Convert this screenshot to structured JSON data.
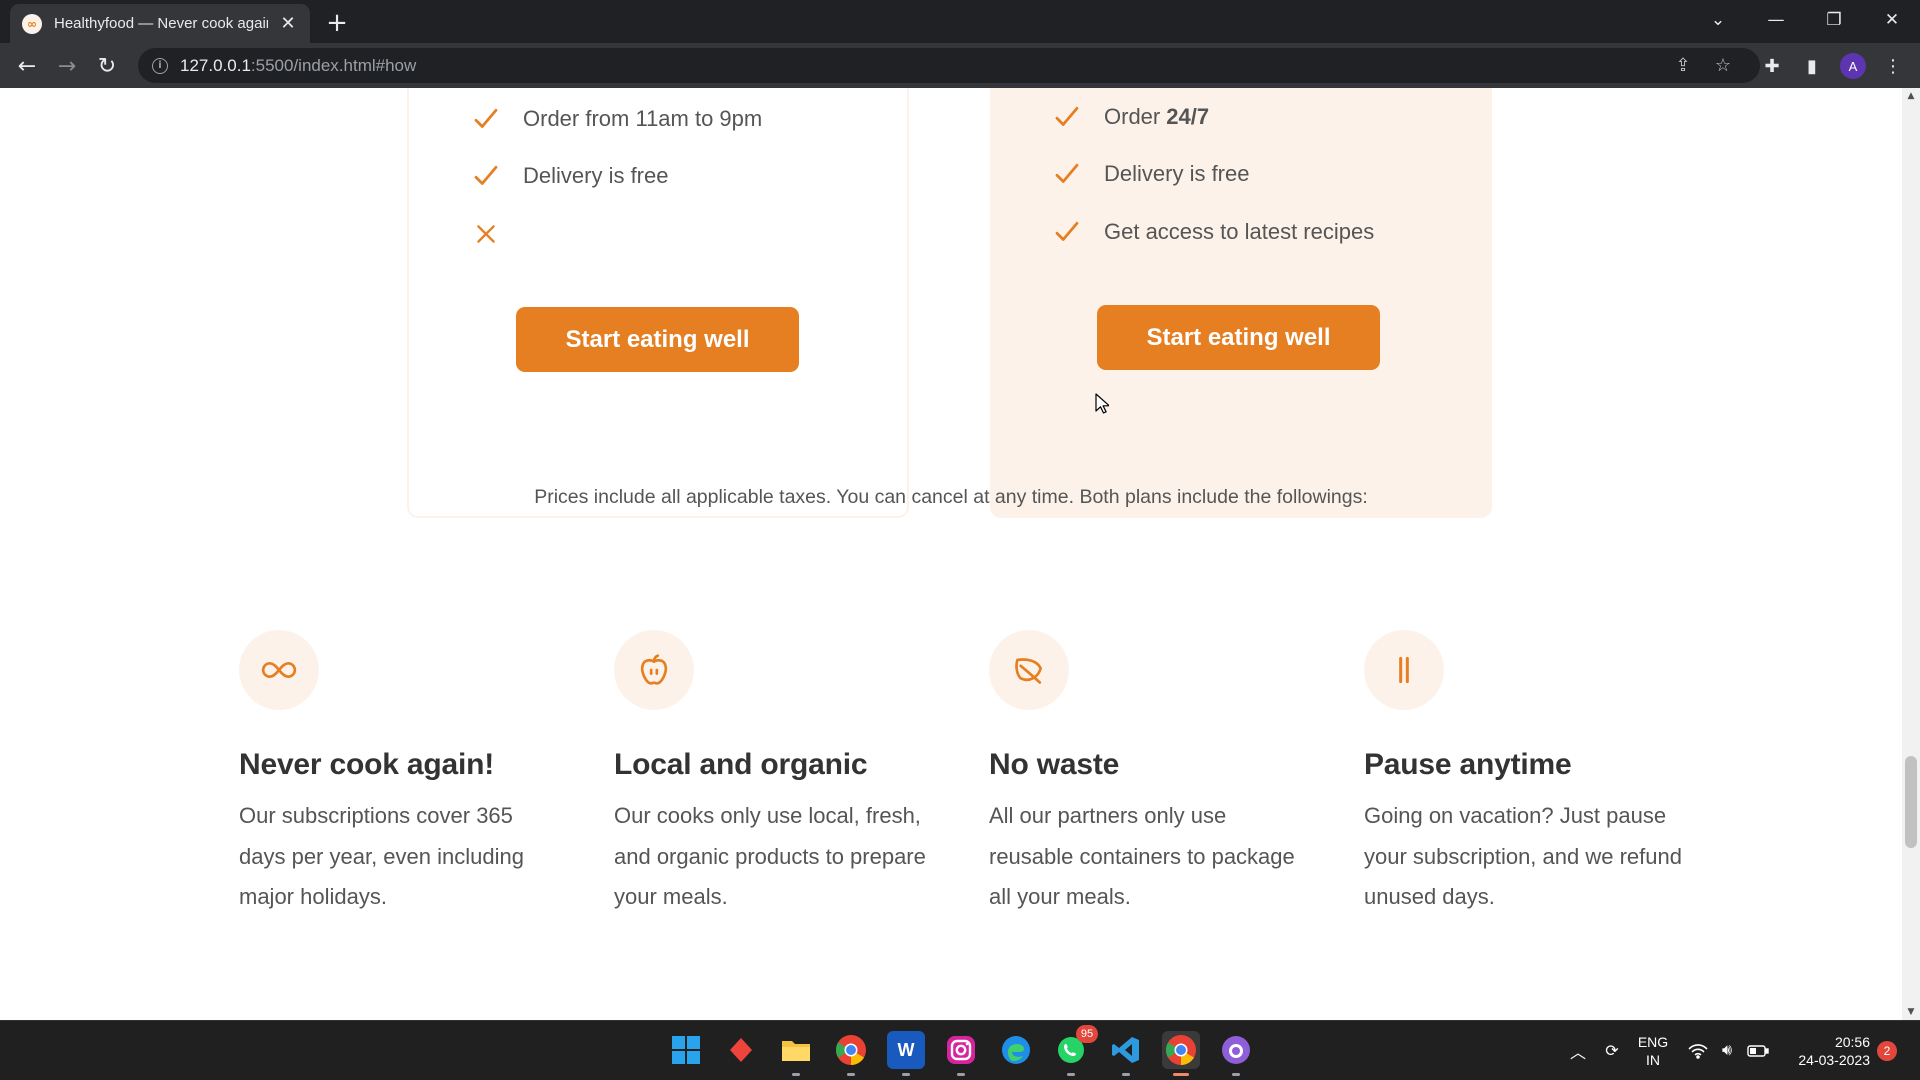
{
  "browser": {
    "tab_title": "Healthyfood — Never cook again!",
    "tab_favicon": "infinity-icon",
    "url_host": "127.0.0.1",
    "url_rest": ":5500/index.html#how",
    "profile_initial": "A"
  },
  "pricing": {
    "starter": {
      "features": [
        {
          "icon": "check-icon",
          "text": "Order from 11am to 9pm",
          "bold": ""
        },
        {
          "icon": "check-icon",
          "text": "Delivery is free",
          "bold": ""
        },
        {
          "icon": "cross-icon",
          "text": "",
          "bold": ""
        }
      ],
      "cta": "Start eating well"
    },
    "complete": {
      "features": [
        {
          "icon": "check-icon",
          "text": "Order",
          "bold": "24/7"
        },
        {
          "icon": "check-icon",
          "text": "Delivery is free",
          "bold": ""
        },
        {
          "icon": "check-icon",
          "text": "Get access to latest recipes",
          "bold": ""
        }
      ],
      "cta": "Start eating well"
    },
    "note": "Prices include all applicable taxes. You can cancel at any time. Both plans include the followings:"
  },
  "features": [
    {
      "icon": "infinity-icon",
      "title": "Never cook again!",
      "text": "Our subscriptions cover 365 days per year, even including major holidays."
    },
    {
      "icon": "apple-icon",
      "title": "Local and organic",
      "text": "Our cooks only use local, fresh, and organic products to prepare your meals."
    },
    {
      "icon": "leaf-icon",
      "title": "No waste",
      "text": "All our partners only use reusable containers to package all your meals."
    },
    {
      "icon": "pause-icon",
      "title": "Pause anytime",
      "text": "Going on vacation? Just pause your subscription, and we refund unused days."
    }
  ],
  "taskbar": {
    "whatsapp_badge": "95",
    "language_line1": "ENG",
    "language_line2": "IN",
    "time": "20:56",
    "date": "24-03-2023",
    "notification_count": "2"
  },
  "colors": {
    "accent": "#e67e22",
    "accent_tint": "#fdf2e9",
    "heading": "#333333",
    "body_text": "#555555"
  }
}
